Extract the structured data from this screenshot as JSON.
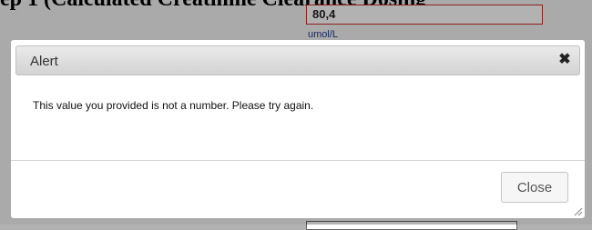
{
  "background": {
    "heading_fragment": "ep 1 (Calculated Creatinine Clearance Dosing",
    "input_value": "80,4",
    "unit": "umol/L"
  },
  "dialog": {
    "title": "Alert",
    "close_icon": "close-icon",
    "message": "This value you provided is not a number. Please try again.",
    "close_button": "Close",
    "resize_icon": "resize-grip-icon"
  }
}
